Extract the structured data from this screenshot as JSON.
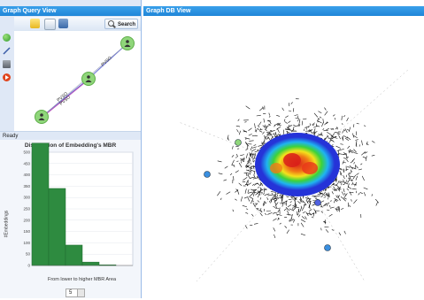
{
  "query_view": {
    "title": "Graph Query View",
    "search_label": "Search",
    "status": "Ready",
    "edge_labels": [
      "PVSO",
      "PVSO",
      "PVSO"
    ]
  },
  "db_view": {
    "title": "Graph DB View"
  },
  "chart_data": {
    "type": "bar",
    "title": "Distribution of Embedding's MBR",
    "xlabel": "From lower to higher MBR Area",
    "ylabel": "#Embeddings",
    "ylim": [
      0,
      500
    ],
    "yticks": [
      0,
      50,
      100,
      150,
      200,
      250,
      300,
      350,
      400,
      450,
      500
    ],
    "values": [
      540,
      340,
      90,
      15,
      3
    ],
    "color": "#2e8b40",
    "bins_value": "5"
  },
  "colors": {
    "title_bar": "#2a92e0",
    "panel_bg": "#dfe8f6",
    "node": "#8fd67a"
  }
}
